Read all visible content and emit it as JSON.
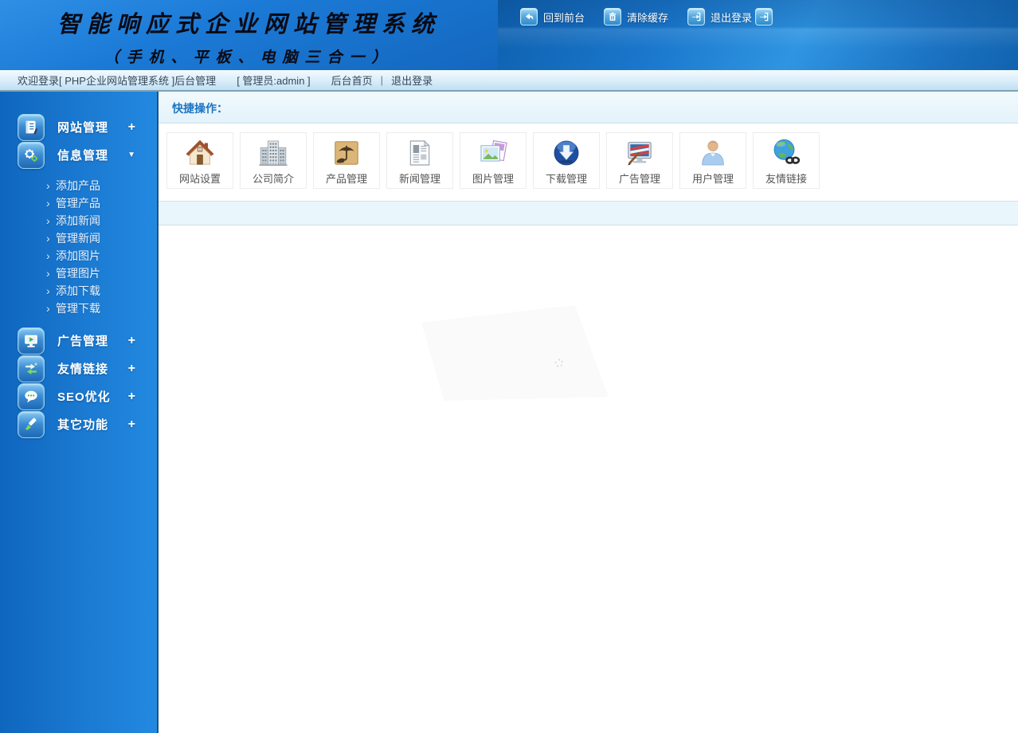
{
  "colors": {
    "header_blue": "#1a77cc",
    "header_left_blue": "#1b7ad6",
    "sidebar_blue_left": "#0f66bd",
    "sidebar_blue_right": "#2389e0",
    "sidebar_border": "#1b5280",
    "accent_text_blue": "#1b74c2",
    "quickbar_bg": "#e3f2fa",
    "welcome_bar_bg": "#d9edf9",
    "welcome_text": "#37475a",
    "shortcut_label": "#555555",
    "cell_border": "#ededed"
  },
  "header": {
    "title": "智能响应式企业网站管理系统",
    "subtitle": "（手机、平板、电脑三合一）",
    "actions": [
      {
        "label": "回到前台",
        "icon": "back-to-site-icon"
      },
      {
        "label": "清除缓存",
        "icon": "clear-cache-icon"
      },
      {
        "label": "退出登录",
        "icon": "logout-icon",
        "trailing_icon": "logout-icon"
      }
    ]
  },
  "welcome": {
    "text": "欢迎登录[ PHP企业网站管理系统 ]后台管理",
    "admin": "[ 管理员:admin ]",
    "home_link": "后台首页",
    "divider": "|",
    "logout_link": "退出登录"
  },
  "sidebar": {
    "submenu_bullet": "›",
    "items": [
      {
        "label": "网站管理",
        "icon": "website-manage-icon",
        "toggle": "+"
      },
      {
        "label": "信息管理",
        "icon": "info-manage-icon",
        "toggle": "▼",
        "expanded": true,
        "children": [
          "添加产品",
          "管理产品",
          "添加新闻",
          "管理新闻",
          "添加图片",
          "管理图片",
          "添加下载",
          "管理下载"
        ]
      },
      {
        "label": "广告管理",
        "icon": "ad-manage-icon",
        "toggle": "+"
      },
      {
        "label": "友情链接",
        "icon": "friend-links-icon",
        "toggle": "+"
      },
      {
        "label": "SEO优化",
        "icon": "seo-icon",
        "toggle": "+"
      },
      {
        "label": "其它功能",
        "icon": "other-tools-icon",
        "toggle": "+"
      }
    ]
  },
  "main": {
    "quick_title": "快捷操作：",
    "shortcuts": [
      {
        "label": "网站设置",
        "icon": "house-icon"
      },
      {
        "label": "公司简介",
        "icon": "building-icon"
      },
      {
        "label": "产品管理",
        "icon": "product-box-icon"
      },
      {
        "label": "新闻管理",
        "icon": "newspaper-icon"
      },
      {
        "label": "图片管理",
        "icon": "photos-icon"
      },
      {
        "label": "下载管理",
        "icon": "download-globe-icon"
      },
      {
        "label": "广告管理",
        "icon": "ad-screen-icon"
      },
      {
        "label": "用户管理",
        "icon": "user-icon"
      },
      {
        "label": "友情链接",
        "icon": "globe-link-icon"
      }
    ]
  }
}
